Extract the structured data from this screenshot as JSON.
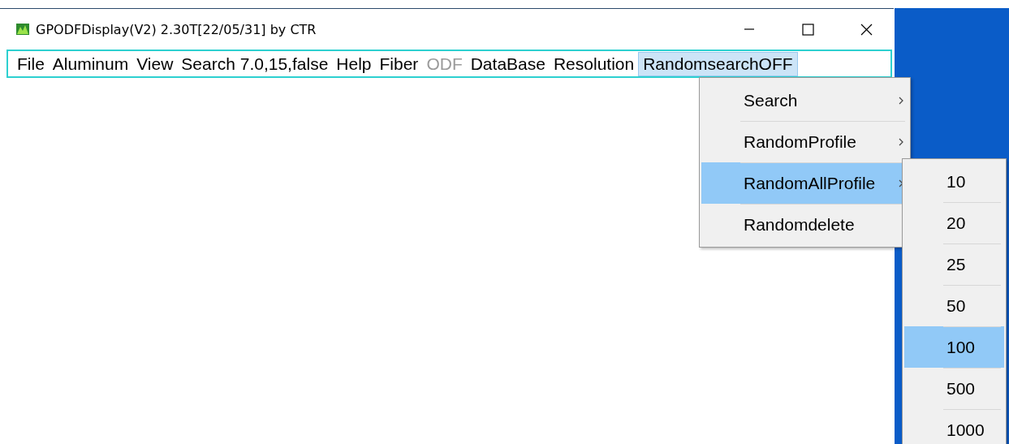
{
  "window": {
    "title": "GPODFDisplay(V2) 2.30T[22/05/31] by CTR"
  },
  "menubar": [
    {
      "label": "File",
      "selected": false,
      "disabled": false
    },
    {
      "label": "Aluminum",
      "selected": false,
      "disabled": false
    },
    {
      "label": "View",
      "selected": false,
      "disabled": false
    },
    {
      "label": "Search 7.0,15,false",
      "selected": false,
      "disabled": false
    },
    {
      "label": "Help",
      "selected": false,
      "disabled": false
    },
    {
      "label": "Fiber",
      "selected": false,
      "disabled": false
    },
    {
      "label": "ODF",
      "selected": false,
      "disabled": true
    },
    {
      "label": "DataBase",
      "selected": false,
      "disabled": false
    },
    {
      "label": "Resolution",
      "selected": false,
      "disabled": false
    },
    {
      "label": "RandomsearchOFF",
      "selected": true,
      "disabled": false
    }
  ],
  "menu": [
    {
      "label": "Search",
      "submenu": true,
      "selected": false
    },
    {
      "label": "RandomProfile",
      "submenu": true,
      "selected": false
    },
    {
      "label": "RandomAllProfile",
      "submenu": true,
      "selected": true
    },
    {
      "label": "Randomdelete",
      "submenu": false,
      "selected": false
    }
  ],
  "submenu": [
    {
      "label": "10",
      "selected": false
    },
    {
      "label": "20",
      "selected": false
    },
    {
      "label": "25",
      "selected": false
    },
    {
      "label": "50",
      "selected": false
    },
    {
      "label": "100",
      "selected": true
    },
    {
      "label": "500",
      "selected": false
    },
    {
      "label": "1000",
      "selected": false
    }
  ]
}
